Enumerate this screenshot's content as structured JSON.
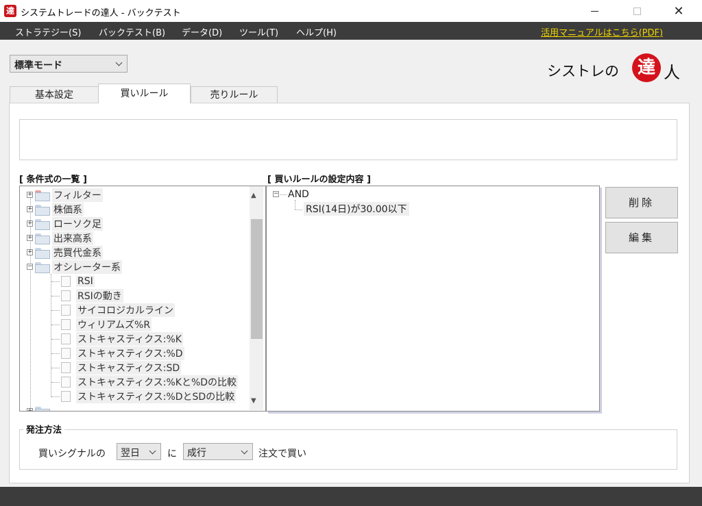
{
  "window": {
    "icon_char": "達",
    "title": "システムトレードの達人 - バックテスト"
  },
  "menu": {
    "items": [
      "ストラテジー(S)",
      "バックテスト(B)",
      "データ(D)",
      "ツール(T)",
      "ヘルプ(H)"
    ],
    "manual_link": "活用マニュアルはこちら(PDF)"
  },
  "mode": {
    "selected": "標準モード"
  },
  "logo": {
    "prefix": "シストレの",
    "seal": "達",
    "suffix": "人"
  },
  "tabs": [
    "基本設定",
    "買いルール",
    "売りルール"
  ],
  "active_tab": "買いルール",
  "conditions": {
    "heading": "[ 条件式の一覧 ]",
    "categories": [
      "フィルター",
      "株価系",
      "ローソク足",
      "出来高系",
      "売買代金系",
      "オシレーター系"
    ],
    "oscillator_items": [
      "RSI",
      "RSIの動き",
      "サイコロジカルライン",
      "ウィリアムズ%R",
      "ストキャスティクス:%K",
      "ストキャスティクス:%D",
      "ストキャスティクス:SD",
      "ストキャスティクス:%Kと%Dの比較",
      "ストキャスティクス:%DとSDの比較"
    ]
  },
  "buy_rule": {
    "heading": "[ 買いルールの設定内容 ]",
    "root": "AND",
    "rule": "RSI(14日)が30.00以下"
  },
  "buttons": {
    "delete": "削除",
    "edit": "編集"
  },
  "order": {
    "heading": "発注方法",
    "prefix": "買いシグナルの",
    "timing": "翌日",
    "connector": "に",
    "type": "成行",
    "suffix": "注文で買い"
  }
}
